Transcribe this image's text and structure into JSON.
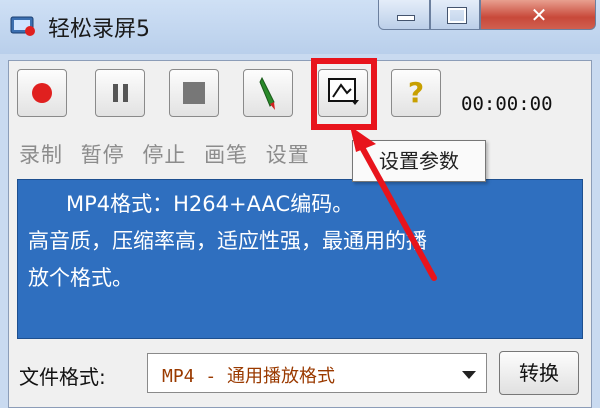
{
  "window": {
    "title": "轻松录屏5",
    "close_glyph": "✕"
  },
  "toolbar": {
    "record_icon": "record-icon",
    "pause_icon": "pause-icon",
    "stop_icon": "stop-icon",
    "pen_icon": "pen-icon",
    "settings_icon": "settings-icon",
    "help_glyph": "?",
    "timer": "00:00:00",
    "labels": [
      "录制",
      "暂停",
      "停止",
      "画笔",
      "设置"
    ],
    "tooltip": "设置参数"
  },
  "description": {
    "line1": "MP4格式：H264+AAC编码。",
    "line2": "高音质，压缩率高，适应性强，最通用的播",
    "line3": "放个格式。"
  },
  "format": {
    "label": "文件格式:",
    "selected": "MP4 - 通用播放格式",
    "convert_label": "转换"
  },
  "colors": {
    "highlight": "#e8141c",
    "description_bg": "#2f6fbf",
    "record": "#e0201f"
  }
}
